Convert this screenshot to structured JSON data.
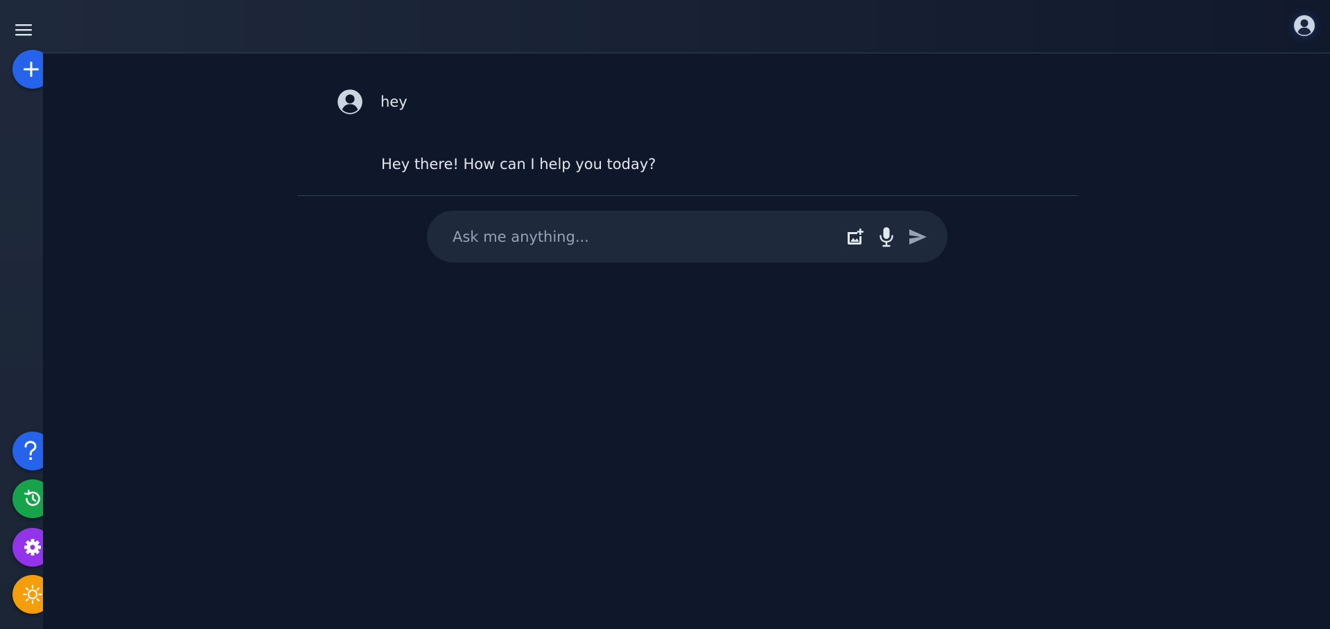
{
  "sidebar": {
    "menu_icon": "hamburger-menu-icon",
    "new_chat_icon": "plus-icon",
    "bottom_buttons": [
      {
        "name": "help",
        "icon": "question-mark-icon",
        "color": "#2563eb"
      },
      {
        "name": "history",
        "icon": "history-icon",
        "color": "#16a34a"
      },
      {
        "name": "settings",
        "icon": "gear-icon",
        "color": "#9333ea"
      },
      {
        "name": "theme",
        "icon": "sun-icon",
        "color": "#f59e0b"
      }
    ]
  },
  "header": {
    "profile_icon": "user-circle-icon"
  },
  "chat": {
    "messages": [
      {
        "role": "user",
        "text": "hey"
      },
      {
        "role": "assistant",
        "text": "Hey there! How can I help you today?"
      }
    ]
  },
  "composer": {
    "placeholder": "Ask me anything...",
    "value": "",
    "icons": [
      "add-image-icon",
      "microphone-icon",
      "send-icon"
    ]
  },
  "colors": {
    "background": "#0f172a",
    "surface": "#1e293b",
    "accent": "#2563eb"
  }
}
